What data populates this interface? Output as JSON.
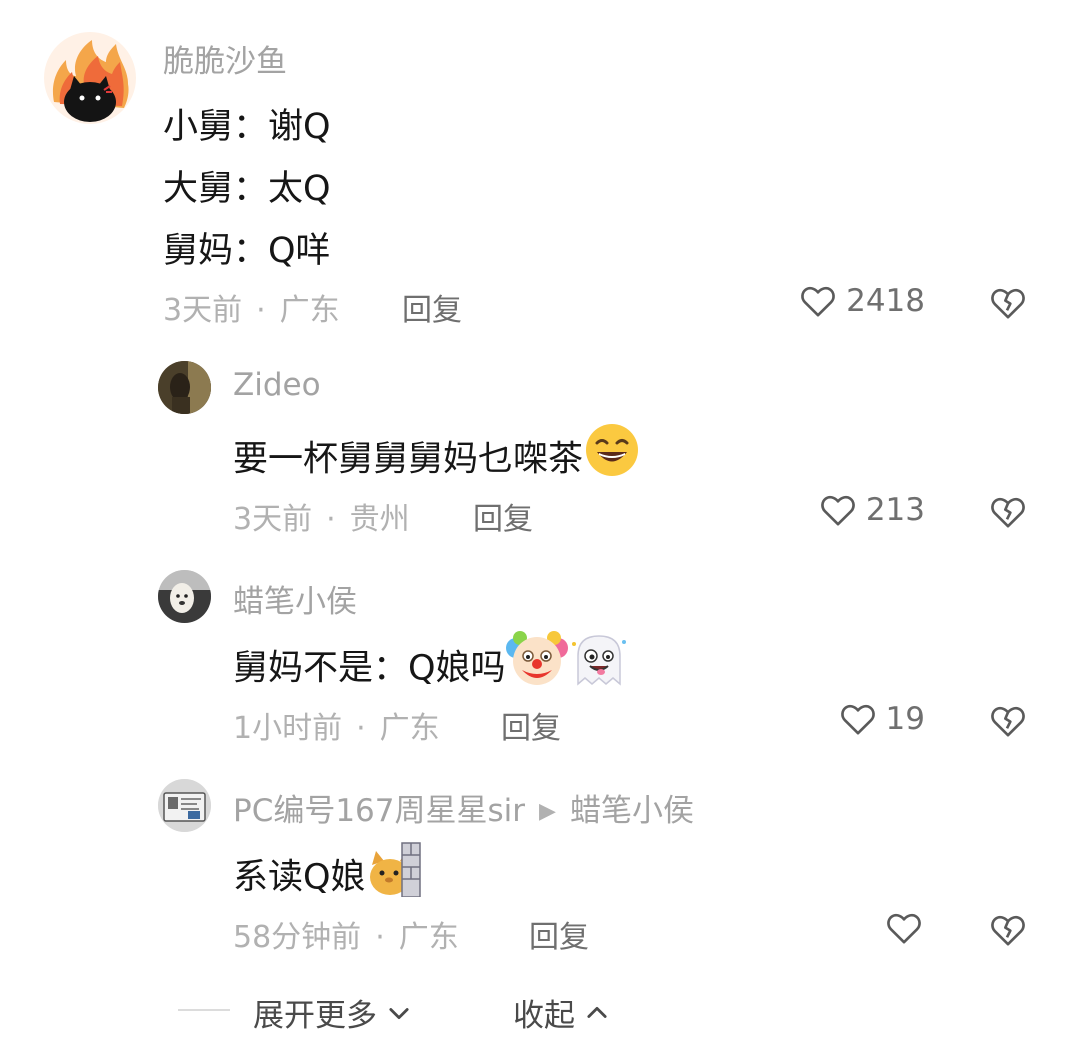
{
  "comments": [
    {
      "username": "脆脆沙鱼",
      "lines": [
        "小舅：谢Q",
        "大舅：太Q",
        "舅妈：Q咩"
      ],
      "time": "3天前",
      "location": "广东",
      "reply_label": "回复",
      "likes": "2418"
    }
  ],
  "replies": [
    {
      "username": "Zideo",
      "text": "要一杯舅舅舅妈乜㗎茶",
      "time": "3天前",
      "location": "贵州",
      "reply_label": "回复",
      "likes": "213"
    },
    {
      "username": "蜡笔小侯",
      "text": "舅妈不是：Q娘吗",
      "time": "1小时前",
      "location": "广东",
      "reply_label": "回复",
      "likes": "19"
    },
    {
      "username": "PC编号167周星星sir",
      "reply_to": "蜡笔小侯",
      "text": "系读Q娘",
      "time": "58分钟前",
      "location": "广东",
      "reply_label": "回复",
      "likes": ""
    }
  ],
  "footer": {
    "expand_label": "展开更多",
    "collapse_label": "收起"
  },
  "icons": {
    "like": "heart-outline-icon",
    "dislike": "broken-heart-icon",
    "expand": "chevron-down-icon",
    "collapse": "chevron-up-icon"
  }
}
